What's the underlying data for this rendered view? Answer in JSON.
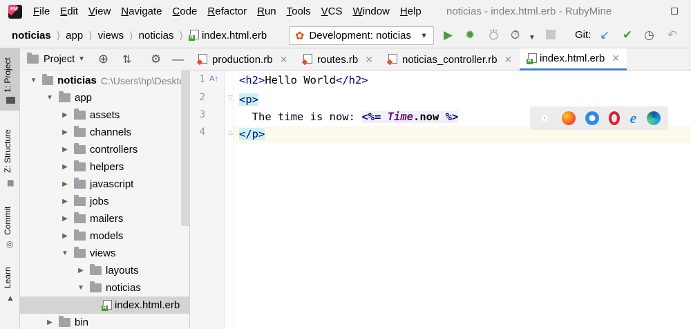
{
  "app": {
    "logo_text": "RM",
    "title": "noticias - index.html.erb - RubyMine"
  },
  "menu": [
    {
      "label": "File",
      "u": "F",
      "rest": "ile"
    },
    {
      "label": "Edit",
      "u": "E",
      "rest": "dit"
    },
    {
      "label": "View",
      "u": "V",
      "rest": "iew"
    },
    {
      "label": "Navigate",
      "u": "N",
      "rest": "avigate"
    },
    {
      "label": "Code",
      "u": "C",
      "rest": "ode"
    },
    {
      "label": "Refactor",
      "u": "R",
      "rest": "efactor"
    },
    {
      "label": "Run",
      "u": "R",
      "rest": "un"
    },
    {
      "label": "Tools",
      "u": "T",
      "rest": "ools"
    },
    {
      "label": "VCS",
      "u": "V",
      "rest": "CS"
    },
    {
      "label": "Window",
      "u": "W",
      "rest": "indow"
    },
    {
      "label": "Help",
      "u": "H",
      "rest": "elp"
    }
  ],
  "breadcrumbs": [
    "noticias",
    "app",
    "views",
    "noticias",
    "index.html.erb"
  ],
  "run_config": "Development: noticias",
  "git_label": "Git:",
  "left_tabs": {
    "project": "1: Project",
    "structure": "Z: Structure",
    "commit": "Commit",
    "learn": "Learn"
  },
  "project_panel": {
    "title": "Project"
  },
  "tree": [
    {
      "label": "noticias",
      "hint": "C:\\Users\\hp\\Desktop",
      "depth": 0,
      "expanded": true,
      "bold": true
    },
    {
      "label": "app",
      "depth": 1,
      "expanded": true
    },
    {
      "label": "assets",
      "depth": 2,
      "expanded": false
    },
    {
      "label": "channels",
      "depth": 2,
      "expanded": false
    },
    {
      "label": "controllers",
      "depth": 2,
      "expanded": false
    },
    {
      "label": "helpers",
      "depth": 2,
      "expanded": false
    },
    {
      "label": "javascript",
      "depth": 2,
      "expanded": false
    },
    {
      "label": "jobs",
      "depth": 2,
      "expanded": false
    },
    {
      "label": "mailers",
      "depth": 2,
      "expanded": false
    },
    {
      "label": "models",
      "depth": 2,
      "expanded": false
    },
    {
      "label": "views",
      "depth": 2,
      "expanded": true
    },
    {
      "label": "layouts",
      "depth": 3,
      "expanded": false
    },
    {
      "label": "noticias",
      "depth": 3,
      "expanded": true
    },
    {
      "label": "index.html.erb",
      "depth": 4,
      "file": true,
      "selected": true
    },
    {
      "label": "bin",
      "depth": 1,
      "expanded": false
    }
  ],
  "tabs": [
    {
      "label": "production.rb",
      "active": false
    },
    {
      "label": "routes.rb",
      "active": false
    },
    {
      "label": "noticias_controller.rb",
      "active": false
    },
    {
      "label": "index.html.erb",
      "active": true
    }
  ],
  "line_numbers": [
    "1",
    "2",
    "3",
    "4"
  ],
  "code": {
    "l1_open": "<h2>",
    "l1_text": "Hello World",
    "l1_close": "</h2>",
    "l2_tag": "<p>",
    "l3_text": "  The time is now: ",
    "l3_open": "<%=",
    "l3_const": "Time",
    "l3_dot": ".",
    "l3_method": "now",
    "l3_close": "%>",
    "l4_tag": "</p>"
  },
  "browsers": [
    "chrome-icon",
    "firefox-icon",
    "safari-icon",
    "opera-icon",
    "ie-icon",
    "edge-icon"
  ]
}
